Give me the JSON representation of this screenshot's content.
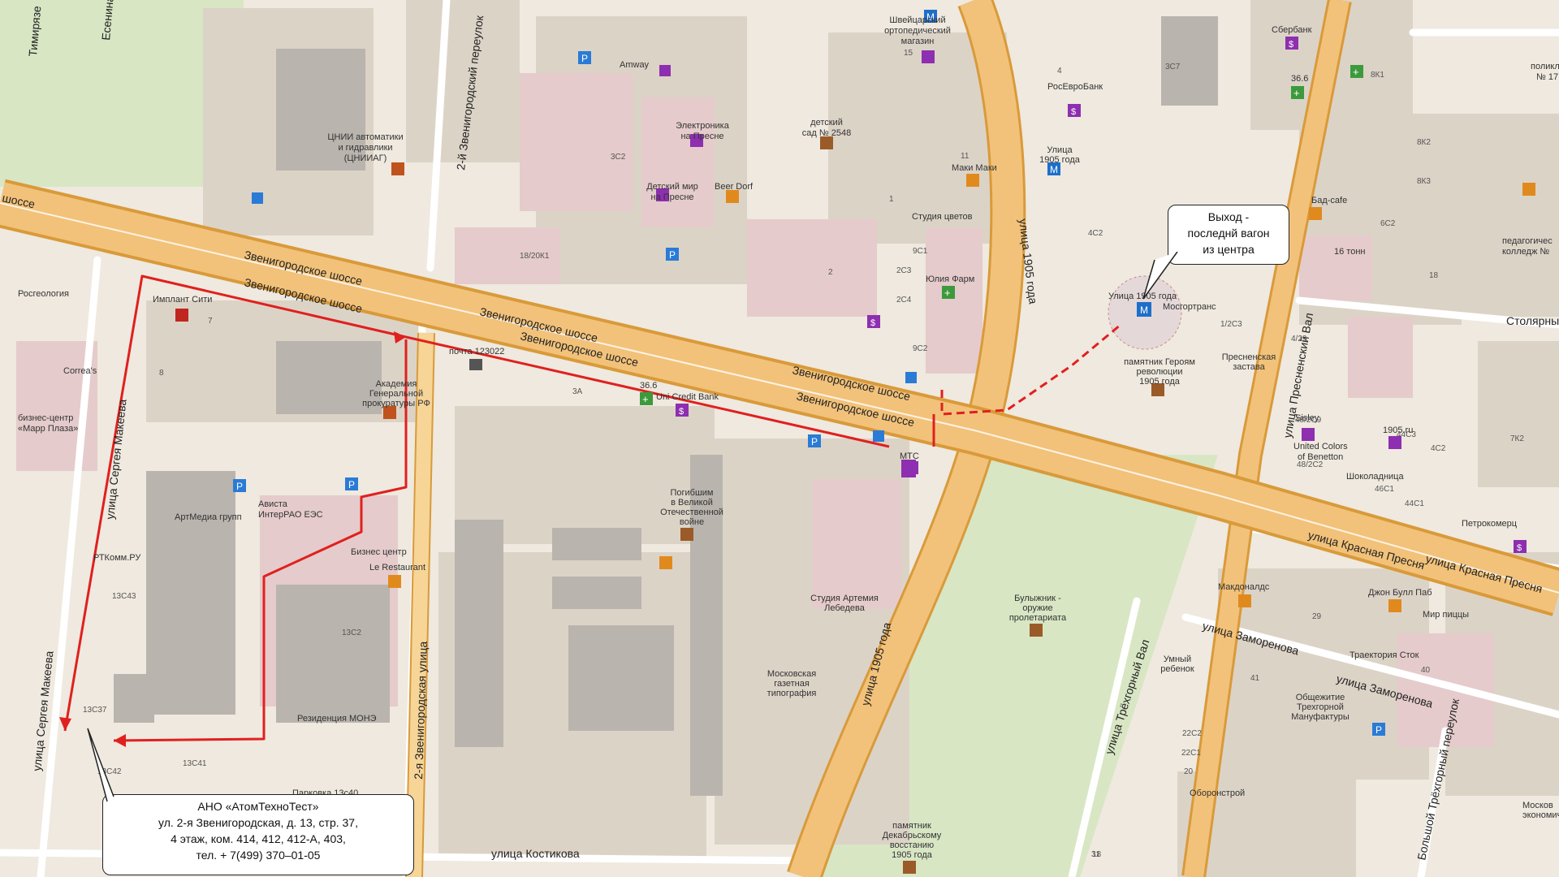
{
  "roads": {
    "zvenigorodskoe": [
      "шоссе",
      "Звенигородское шоссе",
      "Звенигородское шоссе",
      "Звенигородское шоссе",
      "Звенигородское шоссе",
      "Звенигородское шоссе",
      "Звенигородское шоссе"
    ],
    "ulitsa_1905": [
      "улица 1905 года",
      "улица 1905 года"
    ],
    "presnensky_val": "улица Пресненский Вал",
    "krasnaya_presnya": [
      "улица Красная Пресня",
      "улица Красная Пресня"
    ],
    "zamorenova": [
      "улица Заморенова",
      "улица Заморенова"
    ],
    "trekhgorny_val": "улица Трёхгорный Вал",
    "sergeya_makeeva": [
      "улица Сергея Макеева",
      "улица Сергея Макеева"
    ],
    "zvenigorodskaya_2": "2-я Звенигородская улица",
    "zvenigorodsky_per": "2-й Звенигородский переулок",
    "kostikova": "улица Костикова",
    "stolyarny": "Столярны",
    "trekhgorny_per": "Большой Трёхгорный переулок",
    "timiryazeva": "Тимирязе",
    "esenina": "Есенина"
  },
  "places": {
    "tsniiag": [
      "ЦНИИ автоматики",
      "и гидравлики",
      "(ЦНИИАГ)"
    ],
    "amway": "Amway",
    "elektronika": [
      "Электроника",
      "на Пресне"
    ],
    "detsky_mir": [
      "Детский мир",
      "на Пресне"
    ],
    "beer_dorf": "Beer Dorf",
    "shveytsarsky": [
      "Швейцарский",
      "ортопедический",
      "магазин"
    ],
    "detsad": [
      "детский",
      "сад № 2548"
    ],
    "maki": "Маки Маки",
    "studiya_tsvetov": "Студия цветов",
    "yulia_farm": "Юлия Фарм",
    "rosevrobank": "РосЕвроБанк",
    "metro_1905_top": [
      "Улица",
      "1905 года"
    ],
    "metro_1905": "Улица 1905 года",
    "mosgortrans": "Мосгортранс",
    "pamyatnik_geroyam": [
      "памятник Героям",
      "революции",
      "1905 года"
    ],
    "presnenskaya_zastava": [
      "Пресненская",
      "застава"
    ],
    "sberbank": "Сбербанк",
    "apteka_366_top": "36.6",
    "bad_cafe": "Бад-cafe",
    "tonn_16": "16 тонн",
    "policlinic": [
      "поликли",
      "№ 17"
    ],
    "ped_college": [
      "педагогичес",
      "колледж №"
    ],
    "sisley": "Sisley",
    "ucb": [
      "United Colors",
      "of Benetton"
    ],
    "site_1905ru": "1905.ru",
    "shokoladnitsa": "Шоколадница",
    "petrokomerts": "Петрокомерц",
    "makdonalds": "Макдоналдс",
    "john_bull": "Джон Булл Паб",
    "mir_pitsy": "Мир пиццы",
    "traektoriya": "Траектория Сток",
    "umny_rebenok": [
      "Умный",
      "ребенок"
    ],
    "obshchezhitie": [
      "Общежитие",
      "Трехгорной",
      "Мануфактуры"
    ],
    "oboronstroy": "Оборонстрой",
    "bulyzhnik": [
      "Булыжник -",
      "оружие",
      "пролетариата"
    ],
    "pamyatnik_dekabr": [
      "памятник",
      "Декабрьскому",
      "восстанию",
      "1905 года"
    ],
    "studiya_lebedeva": [
      "Студия Артемия",
      "Лебедева"
    ],
    "mosk_gazetnaya": [
      "Московская",
      "газетная",
      "типография"
    ],
    "pogibshim": [
      "Погибшим",
      "в Великой",
      "Отечественной",
      "войне"
    ],
    "pochta": "почта 123022",
    "apteka_366": "36.6",
    "unicredit": "Uni Credit Bank",
    "mts": "МТС",
    "akademia": [
      "Академия",
      "Генеральной",
      "прокуратуры РФ"
    ],
    "avista": "Ависта",
    "inter_rao": "ИнтерРАО ЕЭС",
    "biznes_tsentr": "Бизнес центр",
    "le_restaurant": "Le Restaurant",
    "artmedia": "АртМедиа групп",
    "rtkomm": "РТКомм.РУ",
    "rezidentsiya": "Резиденция МОНЭ",
    "parkovka": "Парковка 13с40",
    "implant": "Имплант Сити",
    "rosgeologia": "Росгеология",
    "correas": "Correa's",
    "marr_plaza": [
      "бизнес-центр",
      "«Марр Плаза»"
    ],
    "moscow_econ": [
      "Москов",
      "экономич"
    ]
  },
  "house_numbers": [
    "15",
    "3С2",
    "18/20К1",
    "3А",
    "4",
    "11",
    "1",
    "2",
    "2С3",
    "2С4",
    "9С1",
    "9С2",
    "4С2",
    "3С7",
    "1/2С3",
    "8К1",
    "8К2",
    "8К3",
    "6С2",
    "18",
    "4/29",
    "48/2С9",
    "44С3",
    "4С2",
    "48/2С2",
    "46С1",
    "44С1",
    "7К2",
    "29",
    "41",
    "40",
    "22С2",
    "22С1",
    "20",
    "31",
    "18",
    "13С2",
    "13С43",
    "13С37",
    "13С41",
    "13С42",
    "7",
    "8"
  ],
  "callout_metro": {
    "lines": [
      "Выход -",
      "последнй вагон",
      "из центра"
    ]
  },
  "callout_office": {
    "lines": [
      "АНО «АтомТехноТест»",
      "ул. 2-я Звенигородская, д. 13, стр. 37,",
      "4 этаж, ком. 414, 412, 412-А, 403,",
      "тел. + 7(499) 370–01-05"
    ]
  },
  "colors": {
    "background": "#efe9df",
    "building": "#d9cfc3",
    "pink_building": "#e3c8c8",
    "main_road": "#f2c27a",
    "road_edge": "#d99a3a",
    "park": "#d8e6c4",
    "route": "#e0201e",
    "metro": "#1e6fc9"
  },
  "icons": [
    "parking-icon",
    "metro-icon",
    "bank-icon",
    "pharmacy-icon",
    "food-icon",
    "shop-icon",
    "monument-icon",
    "post-icon",
    "bus-stop-icon",
    "museum-icon"
  ]
}
